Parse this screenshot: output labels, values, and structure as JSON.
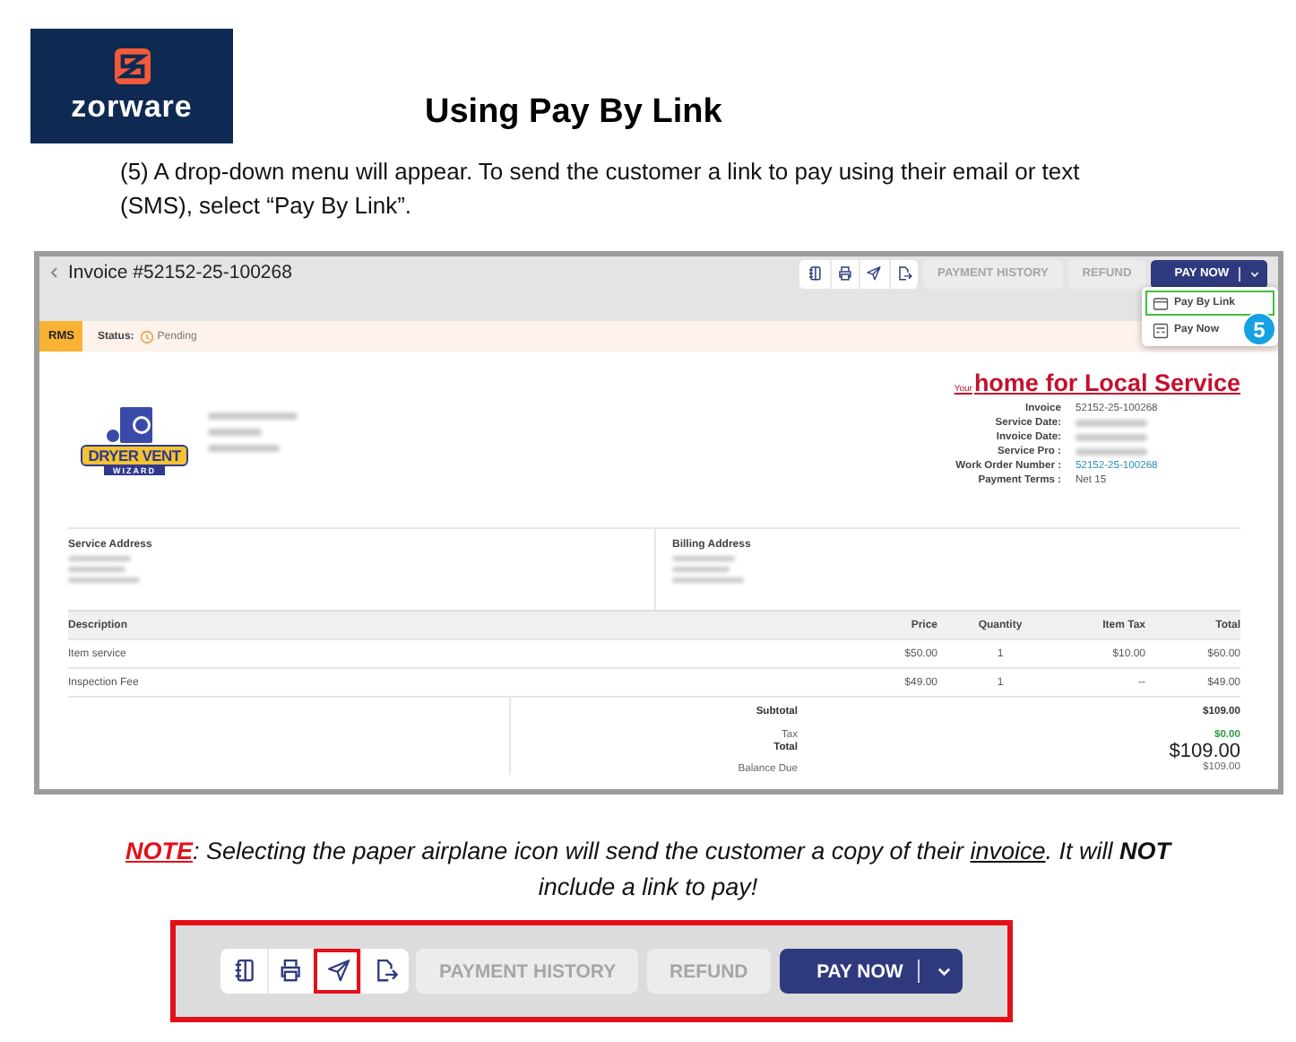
{
  "logo": {
    "text": "zorware"
  },
  "title": "Using Pay By Link",
  "instruction": "(5) A drop-down menu will appear. To send the customer a link to pay using their email or text (SMS), select “Pay By Link”.",
  "screenshot": {
    "invoice_title": "Invoice #52152-25-100268",
    "toolbar": {
      "icon_buttons": [
        {
          "kind": "notebook",
          "outlined": false
        },
        {
          "kind": "print",
          "outlined": false
        },
        {
          "kind": "send",
          "outlined": false
        },
        {
          "kind": "export",
          "outlined": false
        }
      ],
      "buttons": [
        {
          "label": "PAYMENT HISTORY",
          "disabled": true
        },
        {
          "label": "REFUND",
          "disabled": true
        }
      ],
      "primary": {
        "label": "PAY NOW"
      }
    },
    "dropdown": {
      "items": [
        {
          "label": "Pay By Link",
          "highlighted": true,
          "kind": "card"
        },
        {
          "label": "Pay Now",
          "highlighted": false,
          "kind": "terminal"
        }
      ],
      "step_badge": "5"
    },
    "status_bar": {
      "tag": "RMS",
      "label": "Status:",
      "value": "Pending"
    },
    "brand_logo": {
      "line1": "DRYER VENT",
      "line2": "WIZARD"
    },
    "slogan": {
      "prefix": "Your",
      "text": "home for Local Service"
    },
    "invoice_details": [
      {
        "label": "Invoice",
        "value": "52152-25-100268",
        "kind": "plain"
      },
      {
        "label": "Service Date:",
        "kind": "blurred"
      },
      {
        "label": "Invoice Date:",
        "kind": "blurred"
      },
      {
        "label": "Service Pro :",
        "kind": "blurred"
      },
      {
        "label": "Work Order Number :",
        "value": "52152-25-100268",
        "kind": "link"
      },
      {
        "label": "Payment Terms :",
        "value": "Net 15",
        "kind": "plain"
      }
    ],
    "service_address": {
      "heading": "Service Address"
    },
    "billing_address": {
      "heading": "Billing Address"
    },
    "table": {
      "columns": [
        "Description",
        "Price",
        "Quantity",
        "Item Tax",
        "Total"
      ],
      "rows": [
        [
          "Item service",
          "$50.00",
          "1",
          "$10.00",
          "$60.00"
        ],
        [
          "Inspection Fee",
          "$49.00",
          "1",
          "--",
          "$49.00"
        ]
      ]
    },
    "summary": [
      {
        "label": "Subtotal",
        "value": "$109.00",
        "kind": "bold"
      },
      {
        "label": "Tax",
        "value": "$0.00",
        "kind": "positive"
      },
      {
        "label": "Total",
        "value": "$109.00",
        "kind": "large"
      },
      {
        "label": "Balance Due",
        "value": "$109.00",
        "kind": "plain"
      }
    ]
  },
  "note": [
    {
      "text": "NOTE",
      "kind": "alert"
    },
    {
      "text": ": Selecting the paper airplane icon will send the customer a copy of their ",
      "kind": "plain"
    },
    {
      "text": "invoice",
      "kind": "underline"
    },
    {
      "text": ". It will ",
      "kind": "plain"
    },
    {
      "text": "NOT",
      "kind": "bold"
    },
    {
      "text": " include a link to pay!",
      "kind": "plain"
    }
  ],
  "toolbar_closeup": {
    "icon_buttons": [
      {
        "kind": "notebook",
        "outlined": false
      },
      {
        "kind": "print",
        "outlined": false
      },
      {
        "kind": "send",
        "outlined": true
      },
      {
        "kind": "export",
        "outlined": false
      }
    ],
    "buttons": [
      {
        "label": "PAYMENT HISTORY",
        "disabled": true
      },
      {
        "label": "REFUND",
        "disabled": true
      }
    ],
    "primary": {
      "label": "PAY NOW"
    }
  }
}
